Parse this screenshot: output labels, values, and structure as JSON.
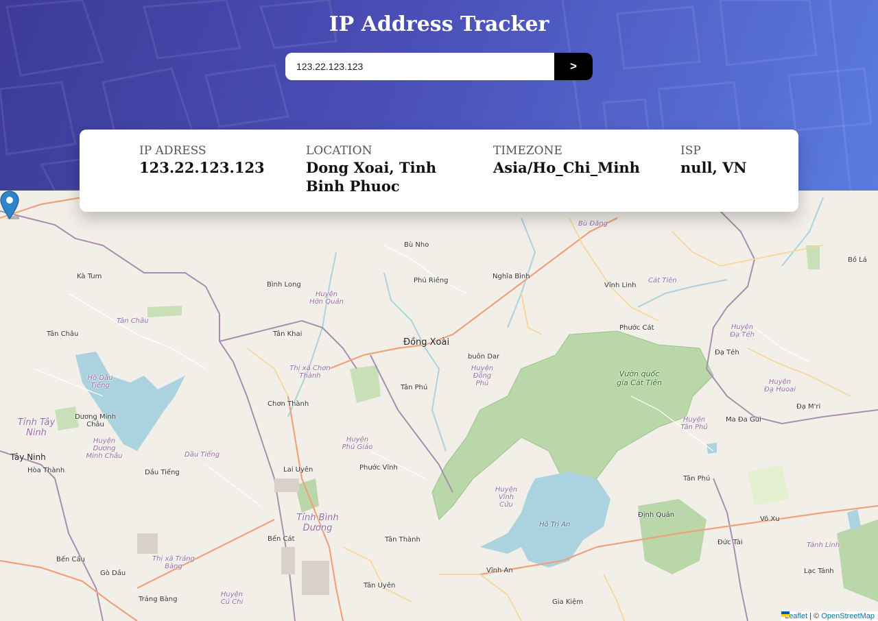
{
  "header": {
    "title": "IP Address Tracker",
    "gradient_colors": [
      "#3d3a98",
      "#4a4fb7",
      "#5b7be0"
    ]
  },
  "search": {
    "value": "123.22.123.123",
    "button_label": ">"
  },
  "info": {
    "ip": {
      "label": "IP ADRESS",
      "value": "123.22.123.123"
    },
    "location": {
      "label": "LOCATION",
      "value": "Dong Xoai, Tinh Binh Phuoc"
    },
    "timezone": {
      "label": "TIMEZONE",
      "value": "Asia/Ho_Chi_Minh"
    },
    "isp": {
      "label": "ISP",
      "value": "null, VN"
    }
  },
  "map": {
    "marker_icon": "map-pin-icon",
    "labels": {
      "dong_xoai": "Đồng Xoài",
      "bu_nho": "Bù Nho",
      "phu_rieng": "Phú Riềng",
      "nghia_binh": "Nghĩa Bình",
      "vinh_linh": "Vĩnh Linh",
      "bu_dang": "Bù Đăng",
      "cat_tien": "Cát Tiên",
      "bo_la": "Bồ Lá",
      "ka_tum": "Kà Tum",
      "binh_long": "Bình Long",
      "huyen_hon_quan": "Huyện Hớn Quản",
      "tan_chau_district": "Tân Châu",
      "tan_chau": "Tân Châu",
      "tan_khai": "Tân Khai",
      "phuoc_cat": "Phước Cát",
      "huyen_da_teh": "Huyện Đạ Tẻh",
      "da_teh": "Đạ Tẻh",
      "buon_dar": "buôn Dar",
      "huyen_dong_phu": "Huyện Đồng Phú",
      "tx_chon_thanh": "Thị xã Chơn Thành",
      "vuon_quoc_gia": "Vườn quốc gia Cát Tiên",
      "huyen_da_huoai": "Huyện Đạ Huoai",
      "ho_dau_tieng": "Hồ Dầu Tiếng",
      "tan_phu": "Tân Phú",
      "chon_thanh": "Chơn Thành",
      "da_mri": "Đạ M'ri",
      "tinh_tay_ninh": "Tỉnh Tây Ninh",
      "duong_minh_chau": "Dương Minh Châu",
      "huyen_tan_phu": "Huyện Tân Phú",
      "ma_da_guoi": "Ma Đa Gui",
      "huyen_duong_minh_chau": "Huyện Dương Minh Châu",
      "huyen_phu_giao": "Huyện Phú Giáo",
      "tay_ninh": "Tây Ninh",
      "hoa_thanh": "Hòa Thành",
      "dau_tieng_district": "Dầu Tiếng",
      "dau_tieng": "Dầu Tiếng",
      "lai_uyen": "Lai Uyên",
      "phuoc_vinh": "Phước Vĩnh",
      "tan_phu_2": "Tân Phú",
      "huyen_vinh_cuu": "Huyện Vĩnh Cửu",
      "dinh_quan": "Định Quán",
      "vo_xu": "Võ Xu",
      "ho_tri_an": "Hồ Trị An",
      "tinh_binh_duong": "Tỉnh Bình Dương",
      "ben_cat": "Bến Cát",
      "tan_thanh": "Tân Thành",
      "duc_tai": "Đức Tài",
      "tanh_linh": "Tánh Linh",
      "ben_cau": "Bến Cầu",
      "tx_trang_bang": "Thị xã Trảng Bàng",
      "go_dau": "Gò Dầu",
      "vinh_an": "Vĩnh An",
      "lac_tanh": "Lạc Tánh",
      "tan_uyen": "Tân Uyên",
      "huyen_cu_chi": "Huyện Củ Chi",
      "trang_bang": "Trảng Bàng",
      "gia_kiem": "Gia Kiệm"
    },
    "colors": {
      "land": "#f2efe9",
      "park": "#b9d7a8",
      "water": "#aad3df",
      "major_road": "#f0a07a",
      "secondary_road": "#f7d79a",
      "boundary": "#a88db0"
    }
  },
  "attribution": {
    "leaflet": "Leaflet",
    "separator": " | © ",
    "osm": "OpenStreetMap"
  }
}
